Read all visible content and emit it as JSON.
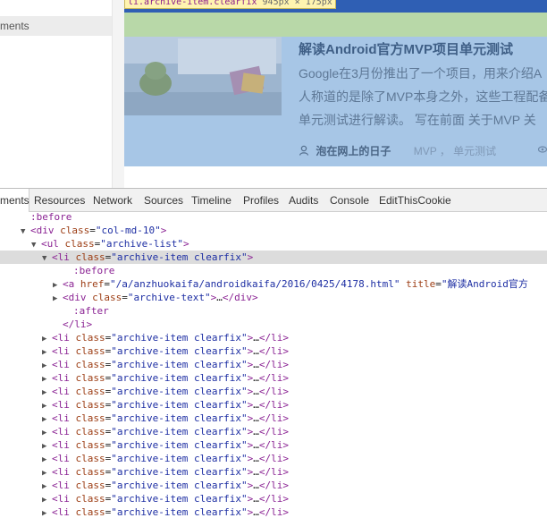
{
  "viewport": {
    "left_selected_text": "ments",
    "tooltip": {
      "tag": "li.archive-item.clearfix",
      "size": "945px × 175px"
    },
    "article": {
      "title": "解读Android官方MVP项目单元测试",
      "lines": [
        "Google在3月份推出了一个项目，用来介绍A",
        "人称道的是除了MVP本身之外，这些工程配备",
        "单元测试进行解读。 写在前面 关于MVP 关"
      ],
      "author": "泡在网上的日子",
      "tags": "MVP ， 单元测试"
    }
  },
  "devtools": {
    "tabs": [
      "ments",
      "Resources",
      "Network",
      "Sources",
      "Timeline",
      "Profiles",
      "Audits",
      "Console",
      "EditThisCookie"
    ],
    "rows": [
      {
        "indent": 2,
        "tri": "",
        "parts": [
          {
            "c": "t-pseudo",
            "t": ":before"
          }
        ]
      },
      {
        "indent": 2,
        "tri": "▼",
        "parts": [
          {
            "c": "t-tag",
            "t": "<div "
          },
          {
            "c": "t-attr",
            "t": "class"
          },
          {
            "c": "t-txt",
            "t": "="
          },
          {
            "c": "t-val",
            "t": "\"col-md-10\""
          },
          {
            "c": "t-tag",
            "t": ">"
          }
        ]
      },
      {
        "indent": 3,
        "tri": "▼",
        "parts": [
          {
            "c": "t-tag",
            "t": "<ul "
          },
          {
            "c": "t-attr",
            "t": "class"
          },
          {
            "c": "t-txt",
            "t": "="
          },
          {
            "c": "t-val",
            "t": "\"archive-list\""
          },
          {
            "c": "t-tag",
            "t": ">"
          }
        ]
      },
      {
        "indent": 4,
        "tri": "▼",
        "selected": true,
        "parts": [
          {
            "c": "t-tag",
            "t": "<li "
          },
          {
            "c": "t-attr",
            "t": "class"
          },
          {
            "c": "t-txt",
            "t": "="
          },
          {
            "c": "t-val",
            "t": "\"archive-item clearfix\""
          },
          {
            "c": "t-tag",
            "t": ">"
          }
        ]
      },
      {
        "indent": 6,
        "tri": "",
        "parts": [
          {
            "c": "t-pseudo",
            "t": ":before"
          }
        ]
      },
      {
        "indent": 5,
        "tri": "▶",
        "parts": [
          {
            "c": "t-tag",
            "t": "<a "
          },
          {
            "c": "t-attr",
            "t": "href"
          },
          {
            "c": "t-txt",
            "t": "="
          },
          {
            "c": "t-val",
            "t": "\"/a/anzhuokaifa/androidkaifa/2016/0425/4178.html\""
          },
          {
            "c": "t-txt",
            "t": " "
          },
          {
            "c": "t-attr",
            "t": "title"
          },
          {
            "c": "t-txt",
            "t": "="
          },
          {
            "c": "t-val",
            "t": "\"解读Android官方"
          }
        ]
      },
      {
        "indent": 5,
        "tri": "▶",
        "parts": [
          {
            "c": "t-tag",
            "t": "<div "
          },
          {
            "c": "t-attr",
            "t": "class"
          },
          {
            "c": "t-txt",
            "t": "="
          },
          {
            "c": "t-val",
            "t": "\"archive-text\""
          },
          {
            "c": "t-tag",
            "t": ">"
          },
          {
            "c": "t-txt",
            "t": "…"
          },
          {
            "c": "t-tag",
            "t": "</div>"
          }
        ]
      },
      {
        "indent": 6,
        "tri": "",
        "parts": [
          {
            "c": "t-pseudo",
            "t": ":after"
          }
        ]
      },
      {
        "indent": 5,
        "tri": "",
        "parts": [
          {
            "c": "t-tag",
            "t": "</li>"
          }
        ]
      },
      {
        "indent": 4,
        "tri": "▶",
        "parts": [
          {
            "c": "t-tag",
            "t": "<li "
          },
          {
            "c": "t-attr",
            "t": "class"
          },
          {
            "c": "t-txt",
            "t": "="
          },
          {
            "c": "t-val",
            "t": "\"archive-item clearfix\""
          },
          {
            "c": "t-tag",
            "t": ">"
          },
          {
            "c": "t-txt",
            "t": "…"
          },
          {
            "c": "t-tag",
            "t": "</li>"
          }
        ]
      },
      {
        "indent": 4,
        "tri": "▶",
        "parts": [
          {
            "c": "t-tag",
            "t": "<li "
          },
          {
            "c": "t-attr",
            "t": "class"
          },
          {
            "c": "t-txt",
            "t": "="
          },
          {
            "c": "t-val",
            "t": "\"archive-item clearfix\""
          },
          {
            "c": "t-tag",
            "t": ">"
          },
          {
            "c": "t-txt",
            "t": "…"
          },
          {
            "c": "t-tag",
            "t": "</li>"
          }
        ]
      },
      {
        "indent": 4,
        "tri": "▶",
        "parts": [
          {
            "c": "t-tag",
            "t": "<li "
          },
          {
            "c": "t-attr",
            "t": "class"
          },
          {
            "c": "t-txt",
            "t": "="
          },
          {
            "c": "t-val",
            "t": "\"archive-item clearfix\""
          },
          {
            "c": "t-tag",
            "t": ">"
          },
          {
            "c": "t-txt",
            "t": "…"
          },
          {
            "c": "t-tag",
            "t": "</li>"
          }
        ]
      },
      {
        "indent": 4,
        "tri": "▶",
        "parts": [
          {
            "c": "t-tag",
            "t": "<li "
          },
          {
            "c": "t-attr",
            "t": "class"
          },
          {
            "c": "t-txt",
            "t": "="
          },
          {
            "c": "t-val",
            "t": "\"archive-item clearfix\""
          },
          {
            "c": "t-tag",
            "t": ">"
          },
          {
            "c": "t-txt",
            "t": "…"
          },
          {
            "c": "t-tag",
            "t": "</li>"
          }
        ]
      },
      {
        "indent": 4,
        "tri": "▶",
        "parts": [
          {
            "c": "t-tag",
            "t": "<li "
          },
          {
            "c": "t-attr",
            "t": "class"
          },
          {
            "c": "t-txt",
            "t": "="
          },
          {
            "c": "t-val",
            "t": "\"archive-item clearfix\""
          },
          {
            "c": "t-tag",
            "t": ">"
          },
          {
            "c": "t-txt",
            "t": "…"
          },
          {
            "c": "t-tag",
            "t": "</li>"
          }
        ]
      },
      {
        "indent": 4,
        "tri": "▶",
        "parts": [
          {
            "c": "t-tag",
            "t": "<li "
          },
          {
            "c": "t-attr",
            "t": "class"
          },
          {
            "c": "t-txt",
            "t": "="
          },
          {
            "c": "t-val",
            "t": "\"archive-item clearfix\""
          },
          {
            "c": "t-tag",
            "t": ">"
          },
          {
            "c": "t-txt",
            "t": "…"
          },
          {
            "c": "t-tag",
            "t": "</li>"
          }
        ]
      },
      {
        "indent": 4,
        "tri": "▶",
        "parts": [
          {
            "c": "t-tag",
            "t": "<li "
          },
          {
            "c": "t-attr",
            "t": "class"
          },
          {
            "c": "t-txt",
            "t": "="
          },
          {
            "c": "t-val",
            "t": "\"archive-item clearfix\""
          },
          {
            "c": "t-tag",
            "t": ">"
          },
          {
            "c": "t-txt",
            "t": "…"
          },
          {
            "c": "t-tag",
            "t": "</li>"
          }
        ]
      },
      {
        "indent": 4,
        "tri": "▶",
        "parts": [
          {
            "c": "t-tag",
            "t": "<li "
          },
          {
            "c": "t-attr",
            "t": "class"
          },
          {
            "c": "t-txt",
            "t": "="
          },
          {
            "c": "t-val",
            "t": "\"archive-item clearfix\""
          },
          {
            "c": "t-tag",
            "t": ">"
          },
          {
            "c": "t-txt",
            "t": "…"
          },
          {
            "c": "t-tag",
            "t": "</li>"
          }
        ]
      },
      {
        "indent": 4,
        "tri": "▶",
        "parts": [
          {
            "c": "t-tag",
            "t": "<li "
          },
          {
            "c": "t-attr",
            "t": "class"
          },
          {
            "c": "t-txt",
            "t": "="
          },
          {
            "c": "t-val",
            "t": "\"archive-item clearfix\""
          },
          {
            "c": "t-tag",
            "t": ">"
          },
          {
            "c": "t-txt",
            "t": "…"
          },
          {
            "c": "t-tag",
            "t": "</li>"
          }
        ]
      },
      {
        "indent": 4,
        "tri": "▶",
        "parts": [
          {
            "c": "t-tag",
            "t": "<li "
          },
          {
            "c": "t-attr",
            "t": "class"
          },
          {
            "c": "t-txt",
            "t": "="
          },
          {
            "c": "t-val",
            "t": "\"archive-item clearfix\""
          },
          {
            "c": "t-tag",
            "t": ">"
          },
          {
            "c": "t-txt",
            "t": "…"
          },
          {
            "c": "t-tag",
            "t": "</li>"
          }
        ]
      },
      {
        "indent": 4,
        "tri": "▶",
        "parts": [
          {
            "c": "t-tag",
            "t": "<li "
          },
          {
            "c": "t-attr",
            "t": "class"
          },
          {
            "c": "t-txt",
            "t": "="
          },
          {
            "c": "t-val",
            "t": "\"archive-item clearfix\""
          },
          {
            "c": "t-tag",
            "t": ">"
          },
          {
            "c": "t-txt",
            "t": "…"
          },
          {
            "c": "t-tag",
            "t": "</li>"
          }
        ]
      },
      {
        "indent": 4,
        "tri": "▶",
        "parts": [
          {
            "c": "t-tag",
            "t": "<li "
          },
          {
            "c": "t-attr",
            "t": "class"
          },
          {
            "c": "t-txt",
            "t": "="
          },
          {
            "c": "t-val",
            "t": "\"archive-item clearfix\""
          },
          {
            "c": "t-tag",
            "t": ">"
          },
          {
            "c": "t-txt",
            "t": "…"
          },
          {
            "c": "t-tag",
            "t": "</li>"
          }
        ]
      },
      {
        "indent": 4,
        "tri": "▶",
        "parts": [
          {
            "c": "t-tag",
            "t": "<li "
          },
          {
            "c": "t-attr",
            "t": "class"
          },
          {
            "c": "t-txt",
            "t": "="
          },
          {
            "c": "t-val",
            "t": "\"archive-item clearfix\""
          },
          {
            "c": "t-tag",
            "t": ">"
          },
          {
            "c": "t-txt",
            "t": "…"
          },
          {
            "c": "t-tag",
            "t": "</li>"
          }
        ]
      },
      {
        "indent": 4,
        "tri": "▶",
        "parts": [
          {
            "c": "t-tag",
            "t": "<li "
          },
          {
            "c": "t-attr",
            "t": "class"
          },
          {
            "c": "t-txt",
            "t": "="
          },
          {
            "c": "t-val",
            "t": "\"archive-item clearfix\""
          },
          {
            "c": "t-tag",
            "t": ">"
          },
          {
            "c": "t-txt",
            "t": "…"
          },
          {
            "c": "t-tag",
            "t": "</li>"
          }
        ]
      },
      {
        "indent": 4,
        "tri": "▶",
        "parts": [
          {
            "c": "t-tag",
            "t": "<li "
          },
          {
            "c": "t-attr",
            "t": "class"
          },
          {
            "c": "t-txt",
            "t": "="
          },
          {
            "c": "t-val",
            "t": "\"archive-item clearfix\""
          },
          {
            "c": "t-tag",
            "t": ">"
          },
          {
            "c": "t-txt",
            "t": "…"
          },
          {
            "c": "t-tag",
            "t": "</li>"
          }
        ]
      }
    ]
  }
}
